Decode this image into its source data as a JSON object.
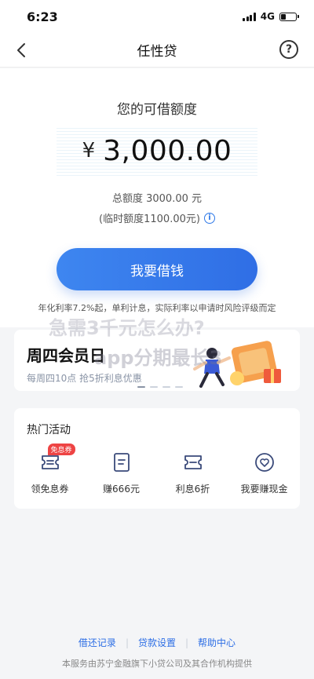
{
  "status_bar": {
    "time": "6:23",
    "network": "4G"
  },
  "nav": {
    "title": "任性贷",
    "help_symbol": "?"
  },
  "quota": {
    "title": "您的可借额度",
    "currency": "¥",
    "amount": "3,000.00",
    "total_text": "总额度 3000.00 元",
    "temp_text": "(临时额度1100.00元)",
    "info_symbol": "i"
  },
  "actions": {
    "borrow_label": "我要借钱"
  },
  "rate_note": "年化利率7.2%起，单利计息，实际利率以申请时风险评级而定",
  "watermark": {
    "line1": "急需3千元怎么办?",
    "line2": "app分期最长3"
  },
  "promo": {
    "title": "周四会员日",
    "subtitle": "每周四10点 抢5折利息优惠"
  },
  "activities": {
    "title": "热门活动",
    "items": [
      {
        "label": "领免息券",
        "badge": "免息券",
        "icon": "coupon-icon"
      },
      {
        "label": "赚666元",
        "badge": "",
        "icon": "document-icon"
      },
      {
        "label": "利息6折",
        "badge": "",
        "icon": "ticket-icon"
      },
      {
        "label": "我要赚现金",
        "badge": "",
        "icon": "heart-shield-icon"
      }
    ]
  },
  "footer": {
    "links": [
      "借还记录",
      "贷款设置",
      "帮助中心"
    ],
    "separator": "|",
    "note": "本服务由苏宁金融旗下小贷公司及其合作机构提供"
  },
  "colors": {
    "accent": "#2f6ee5",
    "badge": "#ee4444",
    "link": "#2d6ee5"
  }
}
